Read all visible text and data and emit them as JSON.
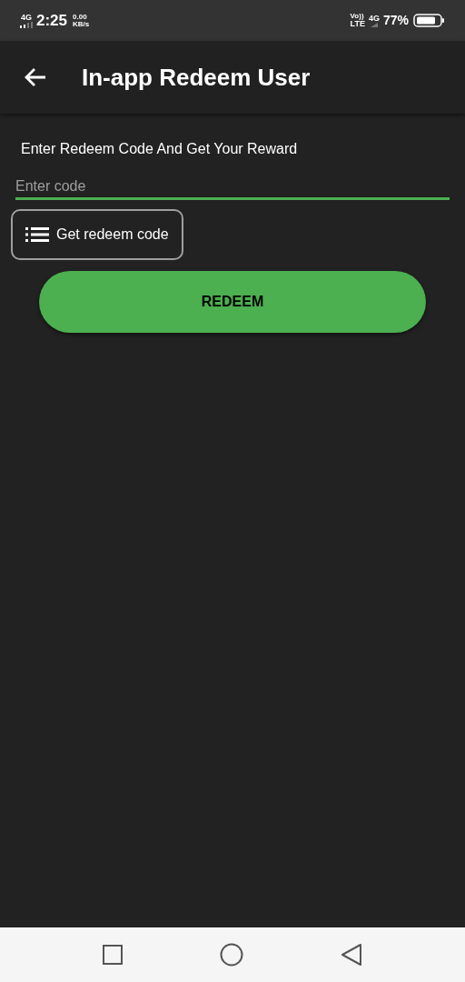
{
  "status_bar": {
    "network": "4G",
    "time": "2:25",
    "speed_value": "0.00",
    "speed_unit": "KB/s",
    "volte_top": "Vo))",
    "volte_bottom": "LTE",
    "network_right": "4G",
    "battery": "77%"
  },
  "app_bar": {
    "title": "In-app Redeem User"
  },
  "prompt": "Enter Redeem Code And Get Your Reward",
  "code_field": {
    "placeholder": "Enter code"
  },
  "get_code_button": {
    "label": "Get redeem code"
  },
  "redeem_button": {
    "label": "REDEEM"
  }
}
